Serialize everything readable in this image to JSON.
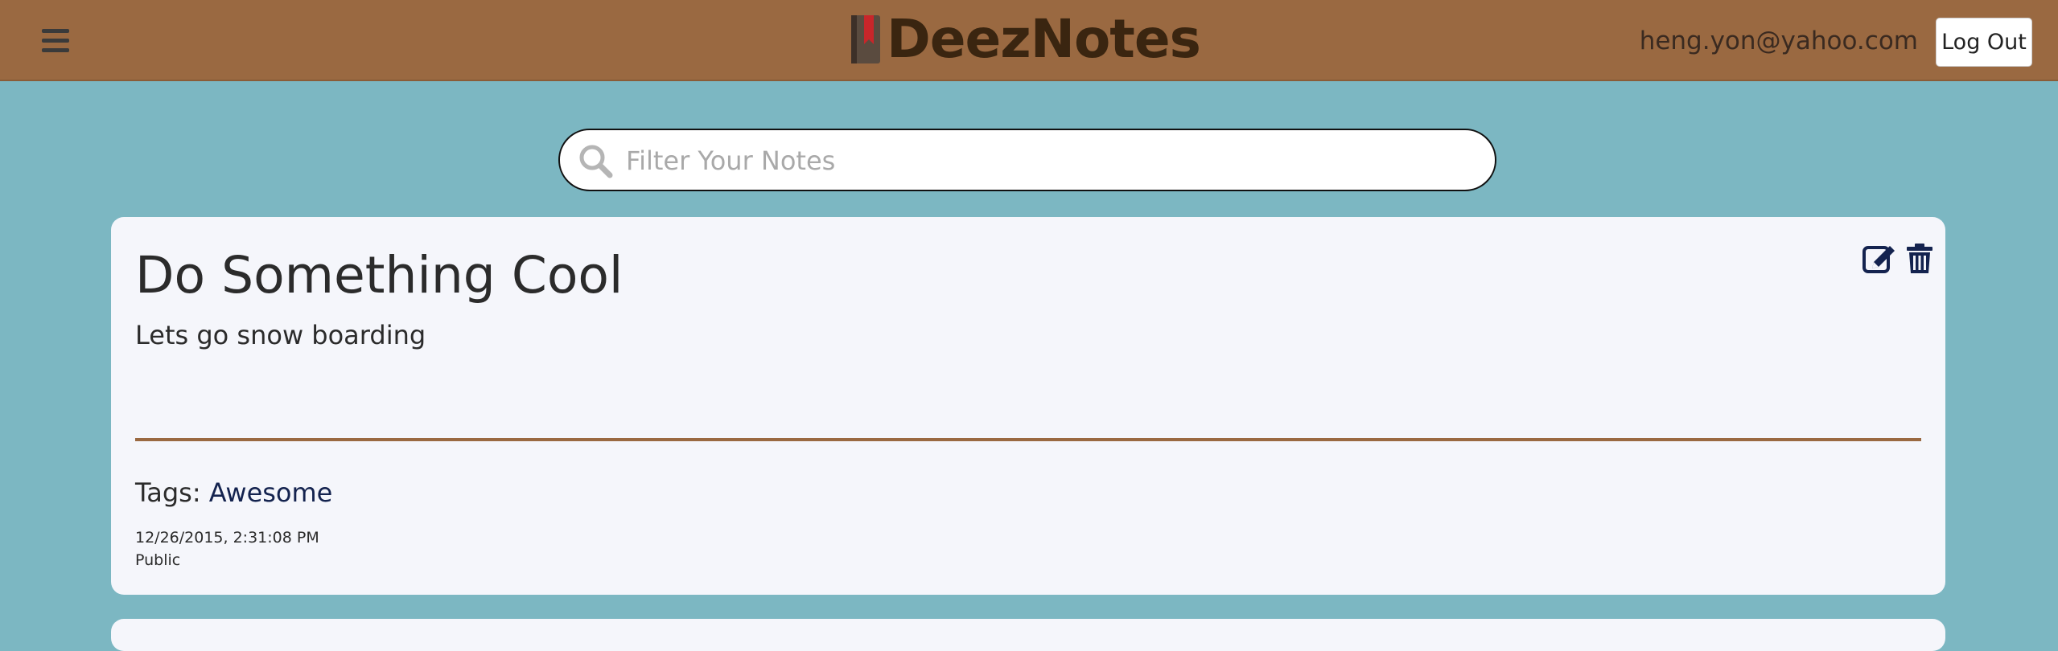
{
  "header": {
    "brand": "DeezNotes",
    "user_email": "heng.yon@yahoo.com",
    "logout_label": "Log Out"
  },
  "search": {
    "placeholder": "Filter Your Notes",
    "value": ""
  },
  "notes": [
    {
      "title": "Do Something Cool",
      "body": "Lets go snow boarding",
      "tags_label": "Tags:",
      "tags": [
        "Awesome"
      ],
      "date": "12/26/2015, 2:31:08 PM",
      "visibility": "Public"
    }
  ],
  "colors": {
    "header_bg": "#9a6941",
    "page_bg": "#7cb7c2",
    "card_bg": "#f5f6fb",
    "icon_navy": "#14234f",
    "brand_text": "#3a2510"
  },
  "icons": {
    "menu": "hamburger-icon",
    "brand": "notebook-icon",
    "search": "search-icon",
    "edit": "edit-icon",
    "delete": "trash-icon"
  }
}
